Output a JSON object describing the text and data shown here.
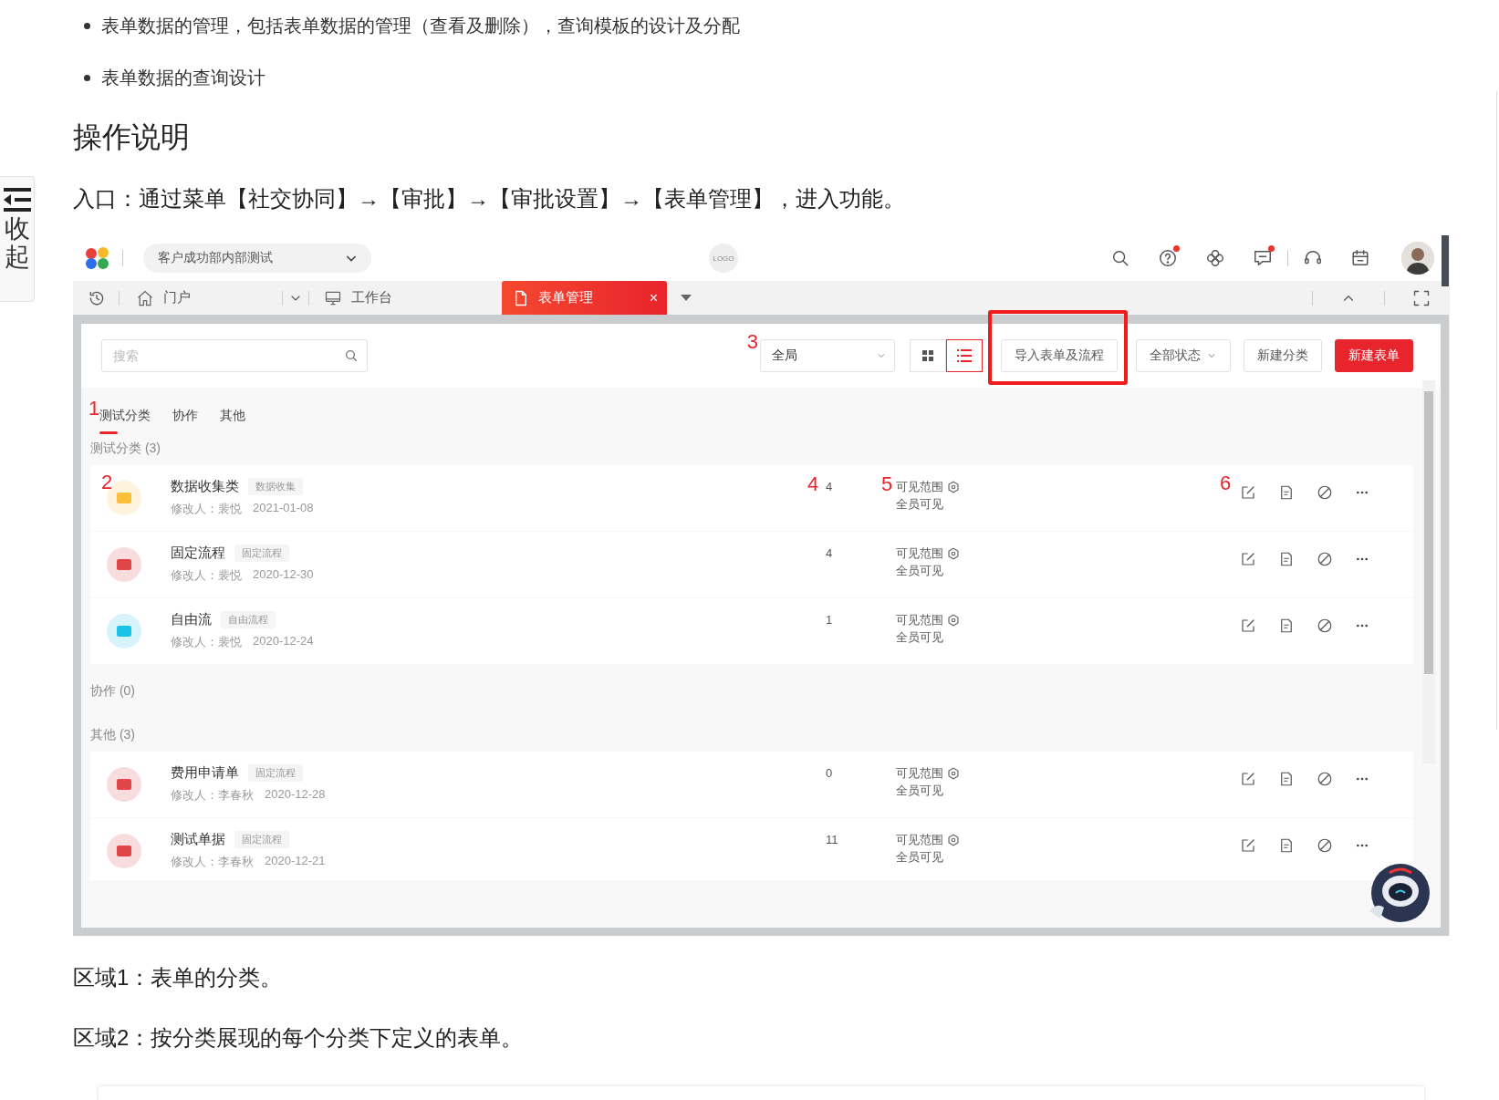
{
  "bullets": [
    "表单数据的管理，包括表单数据的管理（查看及删除），查询模板的设计及分配",
    "表单数据的查询设计"
  ],
  "heading": "操作说明",
  "entry": "入口：通过菜单【社交协同】→【审批】→【审批设置】→【表单管理】，进入功能。",
  "collapse_tab": {
    "label": "收起"
  },
  "app": {
    "org_selector": "客户成功部内部测试",
    "logo_placeholder": "LOGO",
    "top_icons": [
      {
        "kind": "search",
        "badge": false
      },
      {
        "kind": "help",
        "badge": true
      },
      {
        "kind": "apps",
        "badge": false
      },
      {
        "kind": "message",
        "badge": true
      },
      {
        "kind": "headset",
        "badge": false
      },
      {
        "kind": "calendar",
        "badge": false
      }
    ],
    "nav_tabs": [
      {
        "label": "门户",
        "selected": false,
        "kind": "home"
      },
      {
        "label": "工作台",
        "selected": false,
        "kind": "desk"
      },
      {
        "label": "表单管理",
        "selected": true,
        "kind": "doc",
        "close": "×"
      }
    ],
    "search": {
      "placeholder": "搜索"
    },
    "scope_select": {
      "value": "全局",
      "marker": "3"
    },
    "view_toggle": [
      {
        "kind": "grid",
        "selected": false
      },
      {
        "kind": "list",
        "selected": true
      }
    ],
    "buttons": [
      {
        "label": "导入表单及流程",
        "kind": "default",
        "highlighted": true
      },
      {
        "label": "全部状态",
        "kind": "dropdown",
        "highlighted": false
      },
      {
        "label": "新建分类",
        "kind": "default",
        "highlighted": false
      },
      {
        "label": "新建表单",
        "kind": "primary",
        "highlighted": false
      }
    ],
    "category_tabs": {
      "marker": "1",
      "items": [
        {
          "label": "测试分类",
          "selected": true
        },
        {
          "label": "协作",
          "selected": false
        },
        {
          "label": "其他",
          "selected": false
        }
      ]
    },
    "column_markers": {
      "icon": "2",
      "count": "4",
      "visibility": "5",
      "actions": "6"
    },
    "groups": [
      {
        "title": "测试分类 (3)",
        "forms": [
          {
            "name": "数据收集类",
            "tag": "数据收集",
            "modifier": "修改人：裴悦",
            "date": "2021-01-08",
            "count": "4",
            "scope_label": "可见范围",
            "scope": "全员可见",
            "color": "#fbbd3c"
          },
          {
            "name": "固定流程",
            "tag": "固定流程",
            "modifier": "修改人：裴悦",
            "date": "2020-12-30",
            "count": "4",
            "scope_label": "可见范围",
            "scope": "全员可见",
            "color": "#e0454a"
          },
          {
            "name": "自由流",
            "tag": "自由流程",
            "modifier": "修改人：裴悦",
            "date": "2020-12-24",
            "count": "1",
            "scope_label": "可见范围",
            "scope": "全员可见",
            "color": "#1cc3e6"
          }
        ]
      },
      {
        "title": "协作 (0)"
      },
      {
        "title": "其他 (3)",
        "forms": [
          {
            "name": "费用申请单",
            "tag": "固定流程",
            "modifier": "修改人：李春秋",
            "date": "2020-12-28",
            "count": "0",
            "scope_label": "可见范围",
            "scope": "全员可见",
            "color": "#e0454a"
          },
          {
            "name": "测试单据",
            "tag": "固定流程",
            "modifier": "修改人：李春秋",
            "date": "2020-12-21",
            "count": "11",
            "scope_label": "可见范围",
            "scope": "全员可见",
            "color": "#e0454a"
          }
        ]
      }
    ]
  },
  "notes": [
    "区域1：表单的分类。",
    "区域2：按分类展现的每个分类下定义的表单。"
  ]
}
